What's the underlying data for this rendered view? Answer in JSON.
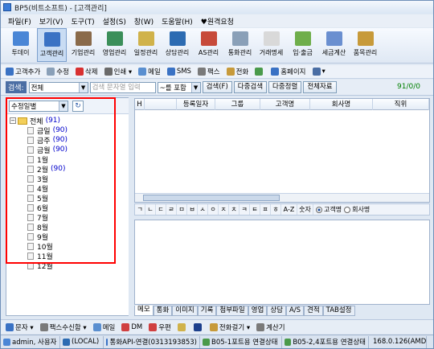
{
  "window": {
    "title": "BP5(비트소프트) - [고객관리]"
  },
  "menu": [
    "파일(F)",
    "보기(V)",
    "도구(T)",
    "설정(S)",
    "창(W)",
    "도움말(H)",
    "♥원격요청"
  ],
  "ribbon": [
    {
      "label": "투데이",
      "icon": "today-icon",
      "color": "#4a86d6"
    },
    {
      "label": "고객관리",
      "icon": "customer-icon",
      "color": "#3a72c4",
      "active": true
    },
    {
      "label": "기업관리",
      "icon": "company-icon",
      "color": "#8a6a4a"
    },
    {
      "label": "영업관리",
      "icon": "sales-icon",
      "color": "#3b8f5a"
    },
    {
      "label": "일정관리",
      "icon": "calendar-icon",
      "color": "#d0b24a"
    },
    {
      "label": "상담관리",
      "icon": "consult-icon",
      "color": "#2c6bb2"
    },
    {
      "label": "AS관리",
      "icon": "tools-icon",
      "color": "#c74a3a"
    },
    {
      "label": "통화관리",
      "icon": "phone-icon",
      "color": "#8aa0b8"
    },
    {
      "label": "거래명세",
      "icon": "invoice-icon",
      "color": "#d9d9d9"
    },
    {
      "label": "입·출금",
      "icon": "money-icon",
      "color": "#6fae4b"
    },
    {
      "label": "세금계산",
      "icon": "tax-icon",
      "color": "#6a8fd0"
    },
    {
      "label": "품목관리",
      "icon": "box-icon",
      "color": "#c79a3a"
    }
  ],
  "toolbar": [
    {
      "label": "고객추가",
      "icon": "add-user-icon",
      "color": "#3a72c4"
    },
    {
      "label": "수정",
      "icon": "edit-icon",
      "color": "#8aa0b8"
    },
    {
      "label": "삭제",
      "icon": "delete-icon",
      "color": "#d83030"
    },
    {
      "label": "인쇄 ▾",
      "icon": "print-icon",
      "color": "#6a6a6a"
    },
    {
      "label": "메일",
      "icon": "mail-icon",
      "color": "#5a8fd0"
    },
    {
      "label": "SMS",
      "icon": "sms-icon",
      "color": "#3a72c4"
    },
    {
      "label": "팩스",
      "icon": "fax-icon",
      "color": "#7a7a7a"
    },
    {
      "label": "전화",
      "icon": "phone-call-icon",
      "color": "#c79a3a"
    },
    {
      "label": "",
      "icon": "sync-icon",
      "color": "#4a9a4a"
    },
    {
      "label": "홈페이지",
      "icon": "home-icon",
      "color": "#3a72c4"
    },
    {
      "label": "▾",
      "icon": "grid-icon",
      "color": "#4a6ea4"
    }
  ],
  "search": {
    "label": "검색:",
    "field": "전체",
    "placeholder": "검색 문자열 입력",
    "mode": "~를 포함",
    "buttons": [
      "검색(F)",
      "다중검색",
      "다중정렬",
      "전체자료"
    ],
    "counter": "91/0/0"
  },
  "left": {
    "sort": "수정일별",
    "root": {
      "label": "전체",
      "count": "(91)"
    },
    "items": [
      {
        "label": "금일",
        "count": "(90)"
      },
      {
        "label": "금주",
        "count": "(90)"
      },
      {
        "label": "금월",
        "count": "(90)"
      },
      {
        "label": "1월",
        "count": ""
      },
      {
        "label": "2월",
        "count": "(90)"
      },
      {
        "label": "3월",
        "count": ""
      },
      {
        "label": "4월",
        "count": ""
      },
      {
        "label": "5월",
        "count": ""
      },
      {
        "label": "6월",
        "count": ""
      },
      {
        "label": "7월",
        "count": ""
      },
      {
        "label": "8월",
        "count": ""
      },
      {
        "label": "9월",
        "count": ""
      },
      {
        "label": "10월",
        "count": ""
      },
      {
        "label": "11월",
        "count": ""
      },
      {
        "label": "12월",
        "count": ""
      }
    ]
  },
  "grid": {
    "columns": [
      "H",
      "",
      "등록일자",
      "그룹",
      "고객명",
      "회사명",
      "직위"
    ]
  },
  "alpha": [
    "ㄱ",
    "ㄴ",
    "ㄷ",
    "ㄹ",
    "ㅁ",
    "ㅂ",
    "ㅅ",
    "ㅇ",
    "ㅈ",
    "ㅊ",
    "ㅋ",
    "ㅌ",
    "ㅍ",
    "ㅎ",
    "A-Z",
    "숫자"
  ],
  "radio": {
    "on": "고객명",
    "off": "회사명"
  },
  "tabs": [
    "메모",
    "통화",
    "이미지",
    "기록",
    "첨부파일",
    "영업",
    "상담",
    "A/S",
    "견적",
    "TAB설정"
  ],
  "bottom": [
    {
      "label": "문자 ▾",
      "icon": "sms2-icon",
      "color": "#3a72c4"
    },
    {
      "label": "팩스수신함 ▾",
      "icon": "fax2-icon",
      "color": "#7a7a7a"
    },
    {
      "label": "메일",
      "icon": "mail2-icon",
      "color": "#5a8fd0"
    },
    {
      "label": "DM",
      "icon": "dm-icon",
      "color": "#d04040"
    },
    {
      "label": "우편",
      "icon": "post-icon",
      "color": "#d04040"
    },
    {
      "label": "",
      "icon": "folder2-icon",
      "color": "#d0b24a"
    },
    {
      "label": "",
      "icon": "book-icon",
      "color": "#1c3f8c"
    },
    {
      "label": "전화걸기 ▾",
      "icon": "dial-icon",
      "color": "#c79a3a"
    },
    {
      "label": "계산기",
      "icon": "calculator-icon",
      "color": "#7a7a7a"
    }
  ],
  "status": [
    {
      "label": "admin, 사용자",
      "icon": "user-status-icon"
    },
    {
      "label": "(LOCAL)",
      "icon": "db-status-icon"
    },
    {
      "label": "통화API-연결(0313193853)",
      "icon": "api-status-icon"
    },
    {
      "label": "B05-1포트용 연결상태",
      "icon": "port1-status-icon"
    },
    {
      "label": "B05-2,4포트용 연결상태",
      "icon": "port2-status-icon"
    },
    {
      "label": "168.0.126(AMD",
      "icon": "net-status-icon"
    }
  ]
}
